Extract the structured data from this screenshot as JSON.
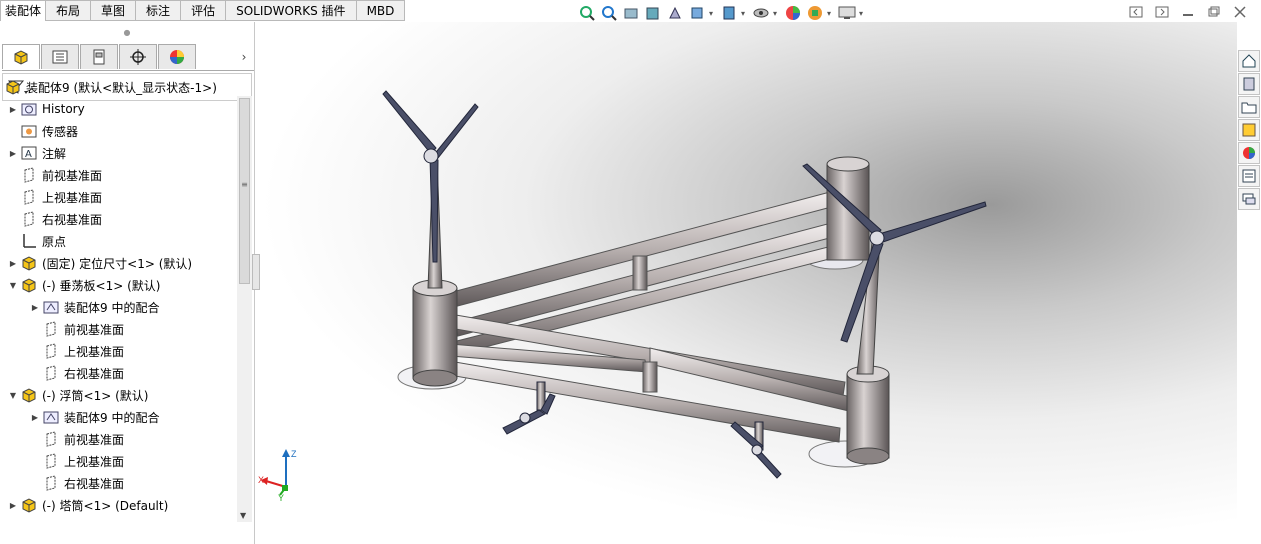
{
  "command_tabs": [
    "装配体",
    "布局",
    "草图",
    "标注",
    "评估",
    "SOLIDWORKS 插件",
    "MBD"
  ],
  "tree": {
    "root": "装配体9  (默认<默认_显示状态-1>)",
    "items": [
      {
        "label": "History",
        "icon": "history-icon",
        "indent": 1,
        "expander": "▶"
      },
      {
        "label": "传感器",
        "icon": "sensor-icon",
        "indent": 1,
        "expander": ""
      },
      {
        "label": "注解",
        "icon": "annotation-icon",
        "indent": 1,
        "expander": "▶"
      },
      {
        "label": "前视基准面",
        "icon": "plane-icon",
        "indent": 1,
        "expander": ""
      },
      {
        "label": "上视基准面",
        "icon": "plane-icon",
        "indent": 1,
        "expander": ""
      },
      {
        "label": "右视基准面",
        "icon": "plane-icon",
        "indent": 1,
        "expander": ""
      },
      {
        "label": "原点",
        "icon": "origin-icon",
        "indent": 1,
        "expander": ""
      },
      {
        "label": "(固定) 定位尺寸<1> (默认)",
        "icon": "part-icon",
        "indent": 1,
        "expander": "▶"
      },
      {
        "label": "(-) 垂荡板<1> (默认)",
        "icon": "part-icon",
        "indent": 1,
        "expander": "▼"
      },
      {
        "label": "装配体9 中的配合",
        "icon": "mates-icon",
        "indent": 2,
        "expander": "▶"
      },
      {
        "label": "前视基准面",
        "icon": "plane-icon",
        "indent": 2,
        "expander": ""
      },
      {
        "label": "上视基准面",
        "icon": "plane-icon",
        "indent": 2,
        "expander": ""
      },
      {
        "label": "右视基准面",
        "icon": "plane-icon",
        "indent": 2,
        "expander": ""
      },
      {
        "label": "(-) 浮筒<1> (默认)",
        "icon": "part-icon",
        "indent": 1,
        "expander": "▼"
      },
      {
        "label": "装配体9 中的配合",
        "icon": "mates-icon",
        "indent": 2,
        "expander": "▶"
      },
      {
        "label": "前视基准面",
        "icon": "plane-icon",
        "indent": 2,
        "expander": ""
      },
      {
        "label": "上视基准面",
        "icon": "plane-icon",
        "indent": 2,
        "expander": ""
      },
      {
        "label": "右视基准面",
        "icon": "plane-icon",
        "indent": 2,
        "expander": ""
      },
      {
        "label": "(-) 塔筒<1> (Default)",
        "icon": "part-icon",
        "indent": 1,
        "expander": "▶"
      }
    ]
  },
  "triad": {
    "x": "X",
    "y": "Y",
    "z": "Z"
  },
  "colors": {
    "accent": "#1e6fbf",
    "frame": "#a89f9c",
    "blade": "#4a4f68"
  }
}
